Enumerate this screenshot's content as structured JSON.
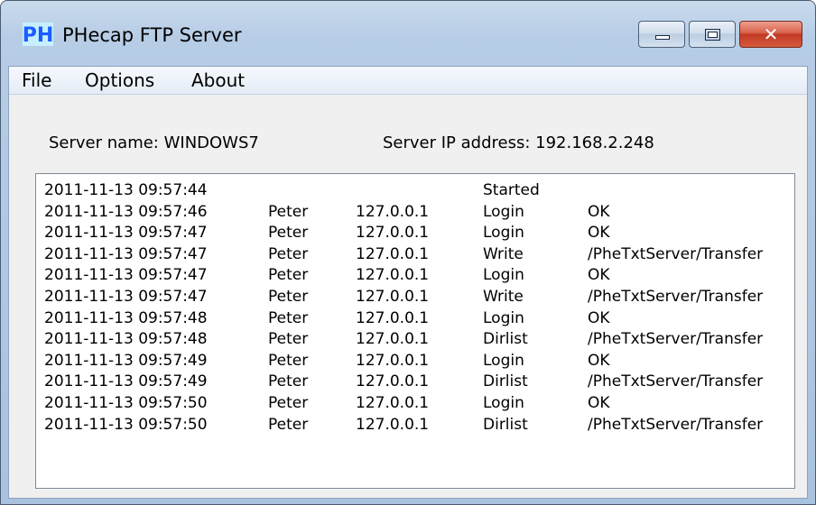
{
  "window": {
    "title": "PHecap FTP Server",
    "icon_text": "PH",
    "icon_color": "#1a5cff"
  },
  "menu": [
    "File",
    "Options",
    "About"
  ],
  "server": {
    "name_label": "Server name: WINDOWS7",
    "ip_label": "Server IP address: 192.168.2.248"
  },
  "log": [
    {
      "timestamp": "2011-11-13 09:57:44",
      "user": "",
      "ip": "",
      "action": "Started",
      "result": ""
    },
    {
      "timestamp": "2011-11-13 09:57:46",
      "user": "Peter",
      "ip": "127.0.0.1",
      "action": "Login",
      "result": "OK"
    },
    {
      "timestamp": "2011-11-13 09:57:47",
      "user": "Peter",
      "ip": "127.0.0.1",
      "action": "Login",
      "result": "OK"
    },
    {
      "timestamp": "2011-11-13 09:57:47",
      "user": "Peter",
      "ip": "127.0.0.1",
      "action": "Write",
      "result": "/PheTxtServer/Transfer"
    },
    {
      "timestamp": "2011-11-13 09:57:47",
      "user": "Peter",
      "ip": "127.0.0.1",
      "action": "Login",
      "result": "OK"
    },
    {
      "timestamp": "2011-11-13 09:57:47",
      "user": "Peter",
      "ip": "127.0.0.1",
      "action": "Write",
      "result": "/PheTxtServer/Transfer"
    },
    {
      "timestamp": "2011-11-13 09:57:48",
      "user": "Peter",
      "ip": "127.0.0.1",
      "action": "Login",
      "result": "OK"
    },
    {
      "timestamp": "2011-11-13 09:57:48",
      "user": "Peter",
      "ip": "127.0.0.1",
      "action": "Dirlist",
      "result": "/PheTxtServer/Transfer"
    },
    {
      "timestamp": "2011-11-13 09:57:49",
      "user": "Peter",
      "ip": "127.0.0.1",
      "action": "Login",
      "result": "OK"
    },
    {
      "timestamp": "2011-11-13 09:57:49",
      "user": "Peter",
      "ip": "127.0.0.1",
      "action": "Dirlist",
      "result": "/PheTxtServer/Transfer"
    },
    {
      "timestamp": "2011-11-13 09:57:50",
      "user": "Peter",
      "ip": "127.0.0.1",
      "action": "Login",
      "result": "OK"
    },
    {
      "timestamp": "2011-11-13 09:57:50",
      "user": "Peter",
      "ip": "127.0.0.1",
      "action": "Dirlist",
      "result": "/PheTxtServer/Transfer"
    }
  ]
}
